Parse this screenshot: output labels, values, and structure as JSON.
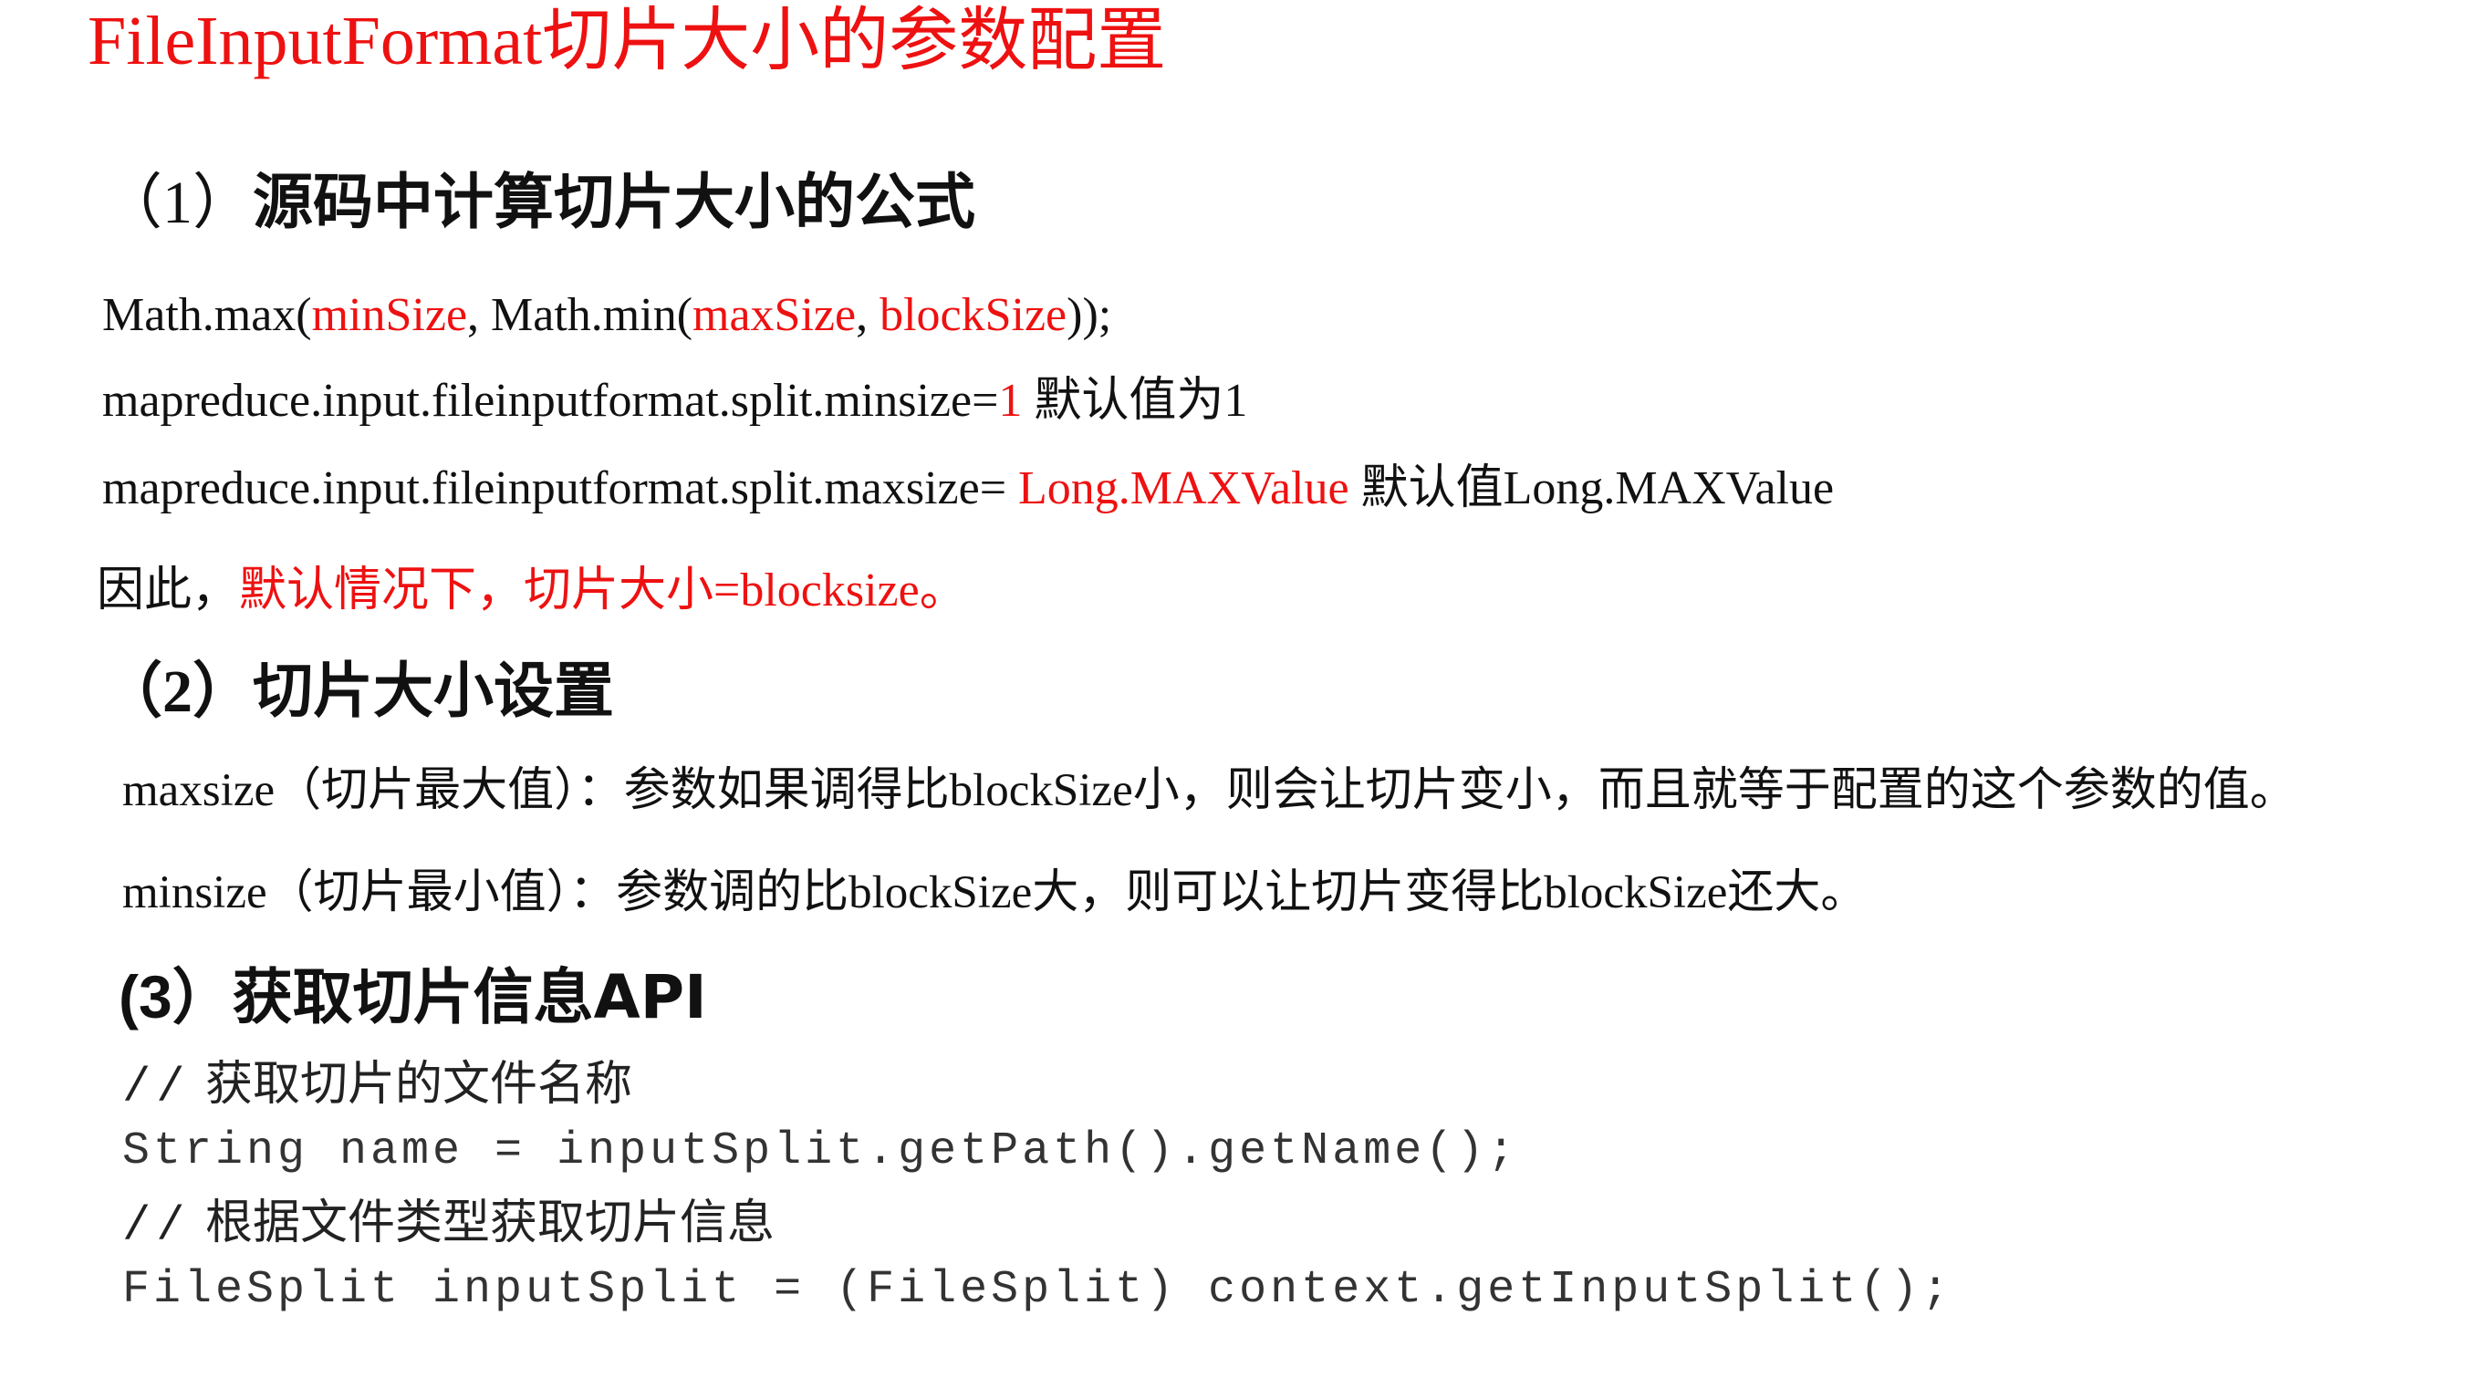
{
  "title": "FileInputFormat切片大小的参数配置",
  "section1": {
    "heading_num": "（1）",
    "heading_text": "源码中计算切片大小的公式",
    "formula": {
      "p1": "Math.max(",
      "minSize": "minSize",
      "p2": ", Math.min(",
      "maxSize": "maxSize",
      "p3": ", ",
      "blockSize": "blockSize",
      "p4": "));"
    },
    "min_line": {
      "key": "mapreduce.input.fileinputformat.split.minsize=",
      "value": "1",
      "note": " 默认值为1"
    },
    "max_line": {
      "key": "mapreduce.input.fileinputformat.split.maxsize= ",
      "value": "Long.MAXValue",
      "note": " 默认值Long.MAXValue"
    },
    "conclusion": {
      "prefix": "因此，",
      "text": "默认情况下，切片大小=blocksize。"
    }
  },
  "section2": {
    "heading_num": "（2）",
    "heading_text": "切片大小设置",
    "maxsize_line": "maxsize（切片最大值）：参数如果调得比blockSize小，则会让切片变小，而且就等于配置的这个参数的值。",
    "minsize_line": "minsize（切片最小值）：参数调的比blockSize大，则可以让切片变得比blockSize还大。"
  },
  "section3": {
    "heading_num": "(3）",
    "heading_text": "获取切片信息API",
    "comment1_slash": "//",
    "comment1_text": " 获取切片的文件名称",
    "code1": "String name = inputSplit.getPath().getName();",
    "comment2_slash": "//",
    "comment2_text": " 根据文件类型获取切片信息",
    "code2": "FileSplit inputSplit = (FileSplit) context.getInputSplit();"
  },
  "colors": {
    "accent_red": "#ee1111",
    "text": "#111111"
  }
}
